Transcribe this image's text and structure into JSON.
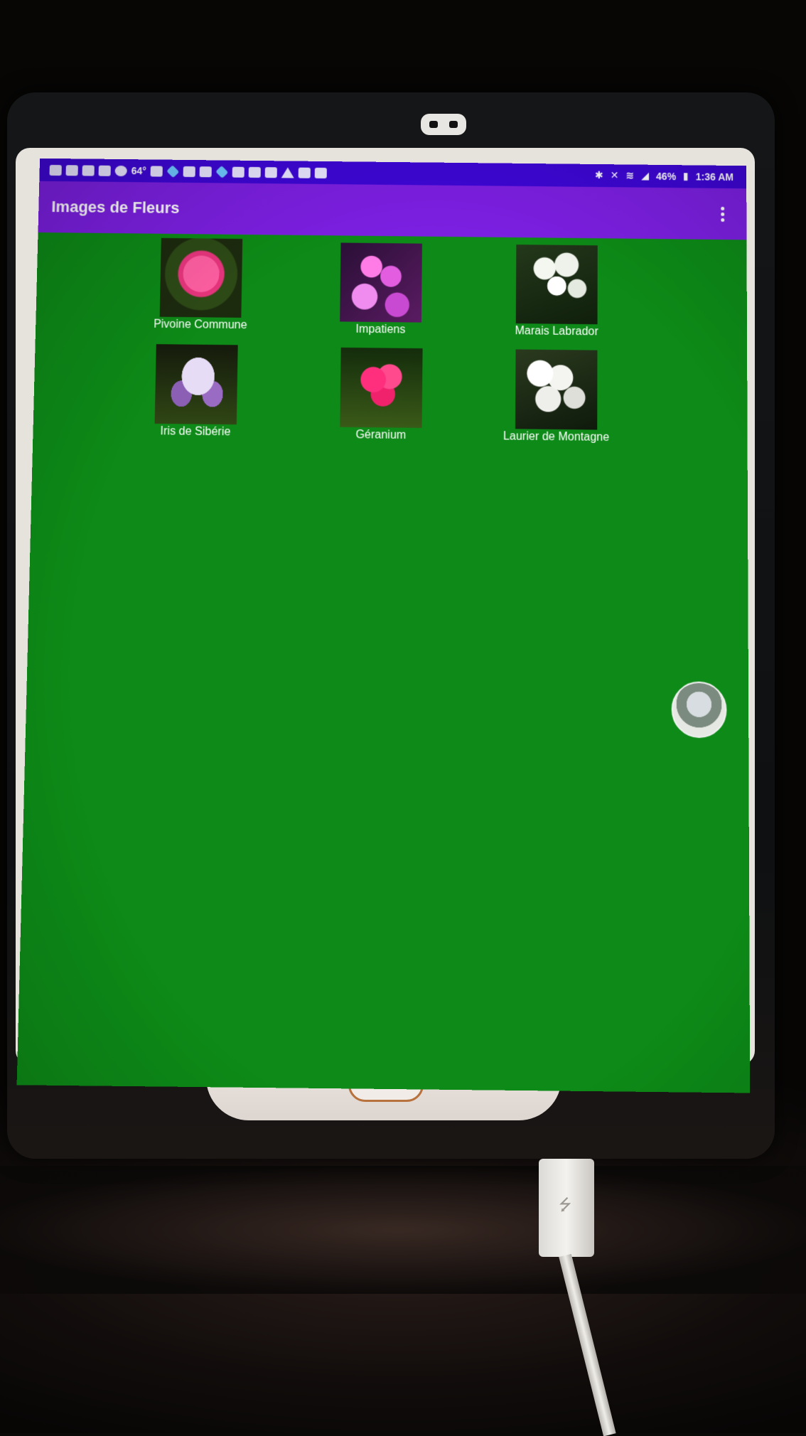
{
  "status_bar": {
    "left_text": "64°",
    "battery": "46%",
    "time": "1:36 AM",
    "icons": [
      "sim-icon",
      "email-icon",
      "mail-icon",
      "shield-icon",
      "refresh-icon",
      "dice-icon",
      "hexagon-icon",
      "image-icon",
      "dice-icon",
      "hexagon-icon",
      "upload-icon",
      "facebook-icon",
      "image-icon",
      "warning-icon",
      "play-store-icon",
      "bag-icon"
    ],
    "right_icons": [
      "bluetooth-icon",
      "mute-icon",
      "wifi-icon",
      "signal-icon",
      "battery-icon"
    ]
  },
  "app_bar": {
    "title": "Images de Fleurs",
    "menu_icon": "more-vert-icon",
    "color": "#7b1fe0"
  },
  "status_bar_color": "#3d06d4",
  "screen_background": "#0d8a17",
  "gallery": [
    {
      "label": "Pivoine Commune",
      "image": "peony"
    },
    {
      "label": "Impatiens",
      "image": "impatiens"
    },
    {
      "label": "Marais Labrador",
      "image": "labrador"
    },
    {
      "label": "Iris de Sibérie",
      "image": "iris"
    },
    {
      "label": "Géranium",
      "image": "geranium"
    },
    {
      "label": "Laurier de Montagne",
      "image": "laurel"
    }
  ]
}
